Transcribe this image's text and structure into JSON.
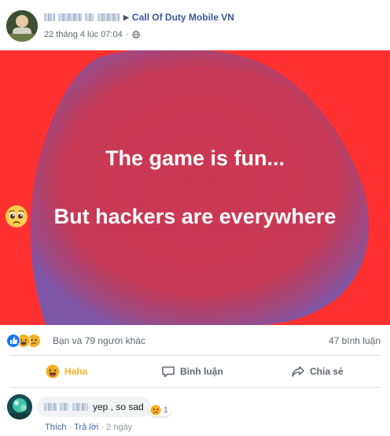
{
  "post": {
    "separator": "▶",
    "group_name": "Call Of Duty Mobile VN",
    "timestamp": "22 tháng 4 lúc 07:04",
    "dot": "·",
    "text_line1": "The game is fun...",
    "text_line2": "But hackers are everywhere",
    "colors": {
      "banner_bg": "#ff3030",
      "blob": "#c8384f",
      "link": "#385898",
      "haha": "#f7b125"
    }
  },
  "stats": {
    "reactions_text": "Bạn và 79 người khác",
    "comments_text": "47 bình luận",
    "reaction_icons": [
      "like-icon",
      "haha-icon",
      "sad-icon"
    ]
  },
  "actions": {
    "haha_label": "Haha",
    "comment_label": "Bình luận",
    "share_label": "Chia sẻ"
  },
  "comment": {
    "text": "yep , so sad",
    "reaction_count": "1",
    "like_label": "Thích",
    "reply_label": "Trả lời",
    "time": "2 ngày",
    "dot": "·"
  }
}
